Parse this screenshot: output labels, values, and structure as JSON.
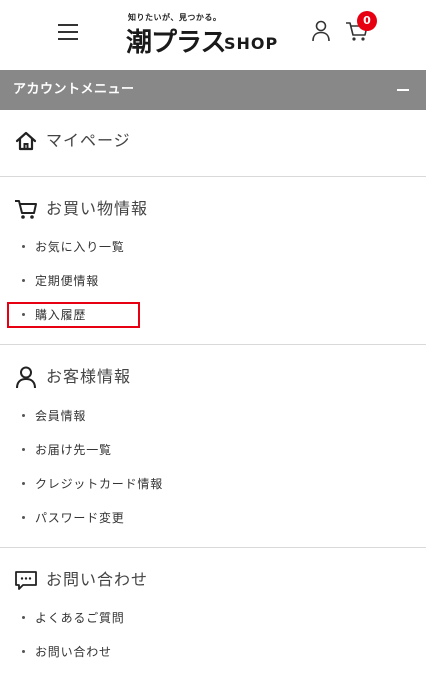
{
  "header": {
    "logo_tagline": "知りたいが、見つかる。",
    "logo_main": "潮プラス",
    "logo_shop": "SHOP",
    "cart_count": "0",
    "icons": {
      "menu": "hamburger-menu-icon",
      "user": "user-icon",
      "cart": "cart-icon"
    },
    "badge_color": "#e60012"
  },
  "account_menu": {
    "title": "アカウントメニュー",
    "toggle_symbol": "minus",
    "bar_color": "#888888"
  },
  "sections": {
    "mypage": {
      "label": "マイページ",
      "icon": "home-icon"
    },
    "shopping": {
      "label": "お買い物情報",
      "icon": "cart-icon",
      "items": [
        "お気に入り一覧",
        "定期便情報",
        "購入履歴"
      ]
    },
    "customer": {
      "label": "お客様情報",
      "icon": "person-icon",
      "items": [
        "会員情報",
        "お届け先一覧",
        "クレジットカード情報",
        "パスワード変更"
      ]
    },
    "inquiry": {
      "label": "お問い合わせ",
      "icon": "chat-icon",
      "items": [
        "よくあるご質問",
        "お問い合わせ"
      ]
    }
  },
  "highlight": {
    "target": "購入履歴",
    "color": "#e60012"
  }
}
